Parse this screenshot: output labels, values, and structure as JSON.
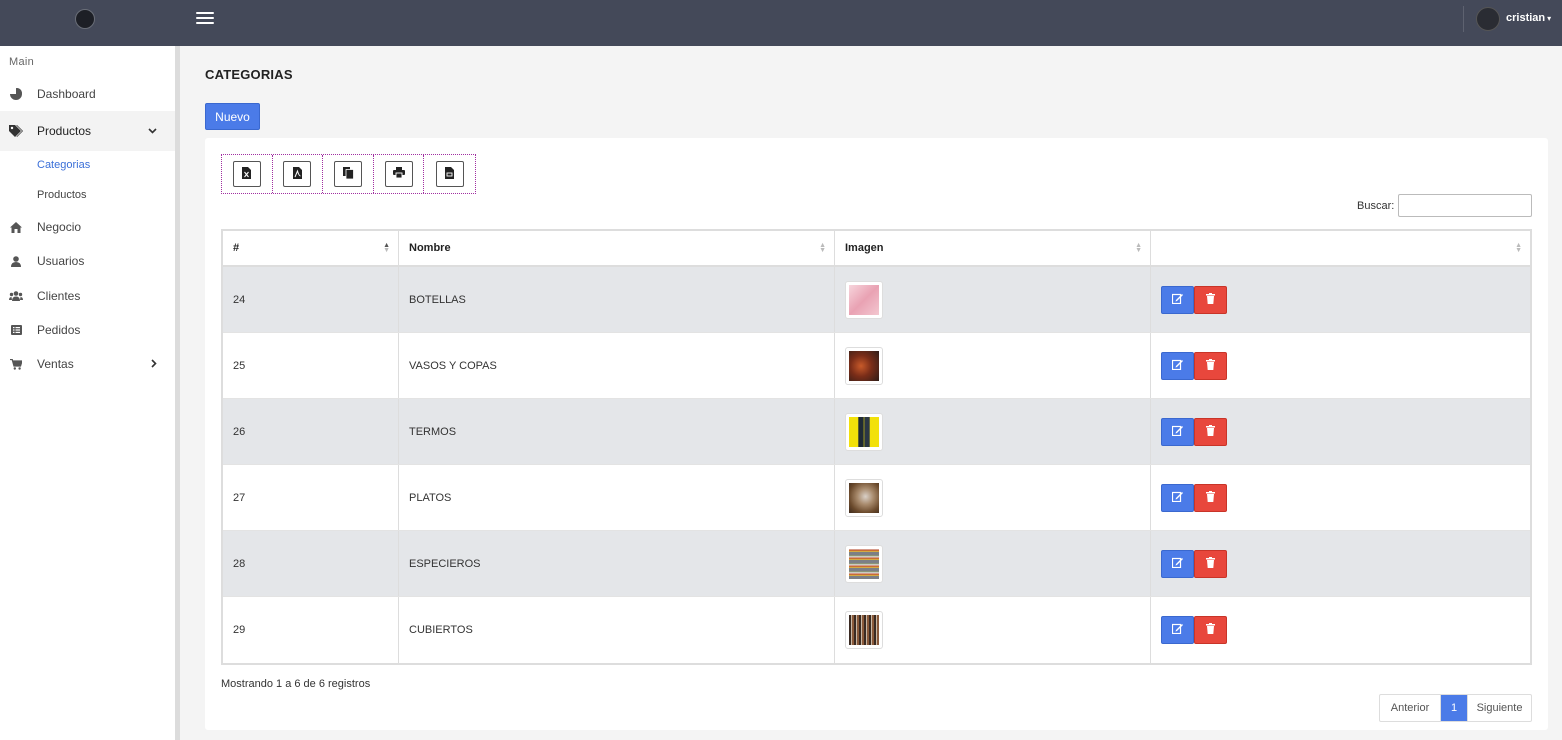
{
  "header": {
    "user_name": "cristian"
  },
  "sidebar": {
    "section": "Main",
    "items": [
      {
        "label": "Dashboard",
        "icon": "chart-pie-icon"
      },
      {
        "label": "Productos",
        "icon": "tags-icon"
      },
      {
        "label": "Negocio",
        "icon": "home-icon"
      },
      {
        "label": "Usuarios",
        "icon": "user-icon"
      },
      {
        "label": "Clientes",
        "icon": "users-icon"
      },
      {
        "label": "Pedidos",
        "icon": "list-icon"
      },
      {
        "label": "Ventas",
        "icon": "cart-icon"
      }
    ],
    "sub_items": [
      {
        "label": "Categorias",
        "active": true
      },
      {
        "label": "Productos",
        "active": false
      }
    ]
  },
  "page": {
    "title": "CATEGORIAS",
    "new_button": "Nuevo"
  },
  "export_buttons": [
    "excel-file-icon",
    "pdf-file-icon",
    "copy-icon",
    "print-icon",
    "csv-file-icon"
  ],
  "search": {
    "label": "Buscar:",
    "value": ""
  },
  "table": {
    "columns": [
      "#",
      "Nombre",
      "Imagen",
      ""
    ],
    "rows": [
      {
        "id": "24",
        "name": "BOTELLAS"
      },
      {
        "id": "25",
        "name": "VASOS Y COPAS"
      },
      {
        "id": "26",
        "name": "TERMOS"
      },
      {
        "id": "27",
        "name": "PLATOS"
      },
      {
        "id": "28",
        "name": "ESPECIEROS"
      },
      {
        "id": "29",
        "name": "CUBIERTOS"
      }
    ]
  },
  "footer": {
    "info": "Mostrando 1 a 6 de 6 registros",
    "prev": "Anterior",
    "current_page": "1",
    "next": "Siguiente"
  },
  "colors": {
    "primary": "#4b7be8",
    "danger": "#e8473c",
    "topbar": "#444959"
  }
}
